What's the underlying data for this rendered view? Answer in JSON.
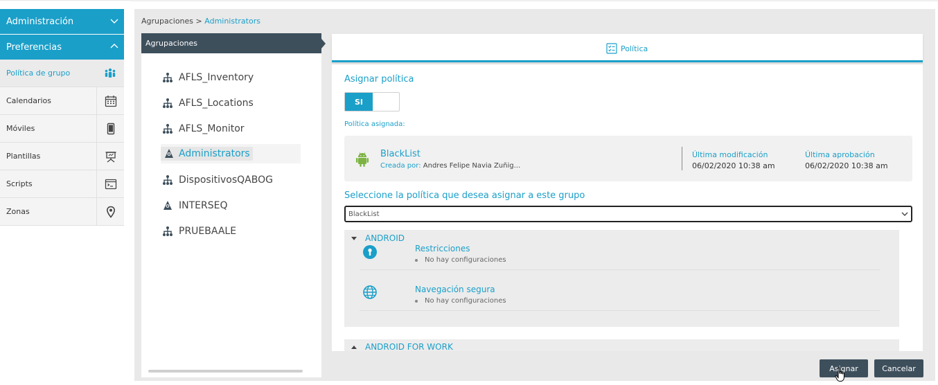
{
  "sidebar": {
    "administration_label": "Administración",
    "preferences_label": "Preferencias",
    "items": [
      {
        "label": "Política de grupo",
        "icon": "group-policy-icon"
      },
      {
        "label": "Calendarios",
        "icon": "calendar-icon"
      },
      {
        "label": "Móviles",
        "icon": "mobile-icon"
      },
      {
        "label": "Plantillas",
        "icon": "presentation-icon"
      },
      {
        "label": "Scripts",
        "icon": "terminal-icon"
      },
      {
        "label": "Zonas",
        "icon": "location-pin-icon"
      }
    ]
  },
  "breadcrumb": {
    "root": "Agrupaciones",
    "separator": " > ",
    "current": "Administrators"
  },
  "groups": {
    "header": "Agrupaciones",
    "items": [
      {
        "label": "AFLS_Inventory"
      },
      {
        "label": "AFLS_Locations"
      },
      {
        "label": "AFLS_Monitor"
      },
      {
        "label": "Administrators"
      },
      {
        "label": "DispositivosQABOG"
      },
      {
        "label": "INTERSEQ"
      },
      {
        "label": "PRUEBAALE"
      }
    ]
  },
  "tab": {
    "label": "Política"
  },
  "assign": {
    "title": "Asignar política",
    "toggle_label": "SI",
    "assigned_label": "Política asignada:"
  },
  "policy_card": {
    "name": "BlackList",
    "created_by_label": "Creada por:",
    "created_by": "Andres Felipe Navia Zuñig...",
    "last_modified_label": "Última modificación",
    "last_modified": "06/02/2020 10:38 am",
    "last_approval_label": "Última aprobación",
    "last_approval": "06/02/2020 10:38 am"
  },
  "select": {
    "label": "Seleccione la política que desea asignar a este grupo",
    "value": "BlackList"
  },
  "sections": {
    "android": {
      "title": "ANDROID",
      "configs": [
        {
          "title": "Restricciones",
          "note": "No hay configuraciones",
          "icon": "restriction-icon"
        },
        {
          "title": "Navegación segura",
          "note": "No hay configuraciones",
          "icon": "globe-icon"
        }
      ]
    },
    "android_work": {
      "title": "ANDROID FOR WORK"
    }
  },
  "buttons": {
    "assign": "Asignar",
    "cancel": "Cancelar"
  },
  "colors": {
    "accent": "#1a9fc9",
    "dark": "#3e4f5c",
    "android": "#7cb342"
  }
}
